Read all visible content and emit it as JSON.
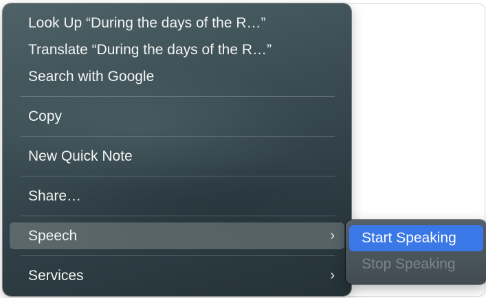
{
  "context_menu": {
    "items": [
      {
        "label": "Look Up “During the days of the R…”"
      },
      {
        "label": "Translate “During the days of the R…”"
      },
      {
        "label": "Search with Google"
      },
      {
        "label": "Copy"
      },
      {
        "label": "New Quick Note"
      },
      {
        "label": "Share…"
      },
      {
        "label": "Speech",
        "chevron": "›"
      },
      {
        "label": "Services",
        "chevron": "›"
      }
    ]
  },
  "speech_submenu": {
    "items": [
      {
        "label": "Start Speaking"
      },
      {
        "label": "Stop Speaking"
      }
    ]
  },
  "colors": {
    "highlight": "#3b78e7",
    "menu_background": "#3f5258"
  },
  "icons": {
    "submenu_indicator": "chevron-right-icon"
  }
}
